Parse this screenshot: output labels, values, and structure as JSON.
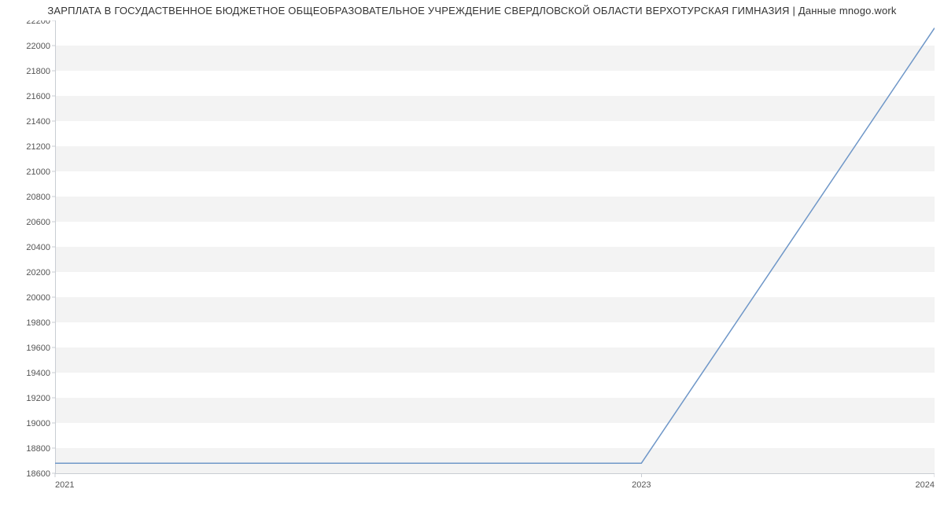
{
  "title": "ЗАРПЛАТА В ГОСУДАСТВЕННОЕ БЮДЖЕТНОЕ ОБЩЕОБРАЗОВАТЕЛЬНОЕ УЧРЕЖДЕНИЕ СВЕРДЛОВСКОЙ ОБЛАСТИ ВЕРХОТУРСКАЯ ГИМНАЗИЯ | Данные mnogo.work",
  "chart_data": {
    "type": "line",
    "x": [
      2021,
      2023,
      2024
    ],
    "y": [
      18680,
      18680,
      22140
    ],
    "x_ticks": [
      2021,
      2023,
      2024
    ],
    "y_ticks": [
      18600,
      18800,
      19000,
      19200,
      19400,
      19600,
      19800,
      20000,
      20200,
      20400,
      20600,
      20800,
      21000,
      21200,
      21400,
      21600,
      21800,
      22000,
      22200
    ],
    "xlim": [
      2021,
      2024
    ],
    "ylim": [
      18600,
      22200
    ],
    "xlabel": "",
    "ylabel": "",
    "grid": "horizontal-bands",
    "line_color": "#6f97c8"
  }
}
